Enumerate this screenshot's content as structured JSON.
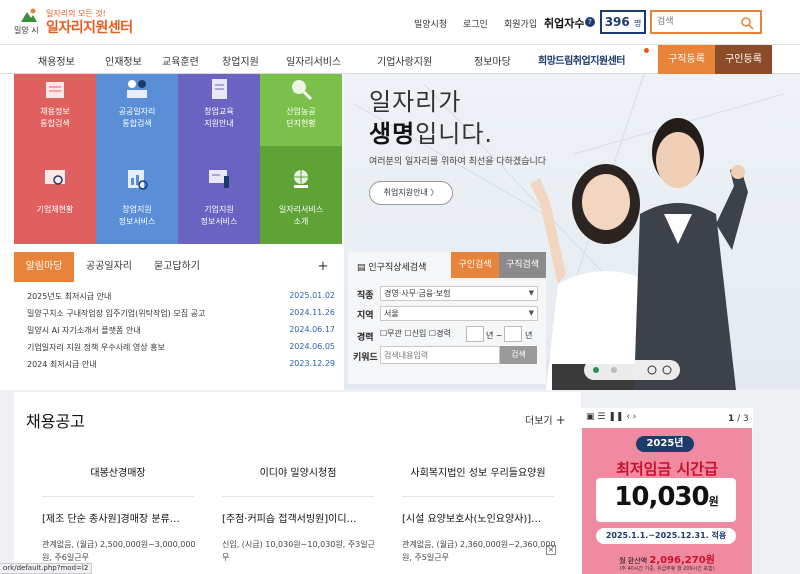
{
  "header": {
    "logo_slogan": "일자리의 모든 것!",
    "logo_title": "일자리지원센터",
    "logo_city": "밀양 시",
    "links": [
      "밀양시청",
      "로그인",
      "회원가입"
    ],
    "job_count_label": "취업자수",
    "job_count_value": "396",
    "job_count_unit": "명",
    "search_placeholder": "검색"
  },
  "nav": {
    "items": [
      "채용정보",
      "인재정보",
      "교육훈련",
      "창업지원",
      "일자리서비스",
      "기업사랑지원",
      "정보마당"
    ],
    "brand": "희망드림취업지원센터",
    "btn_job_post": "구직등록",
    "btn_hire_post": "구인등록"
  },
  "tiles": [
    {
      "label1": "채용정보",
      "label2": "통합검색",
      "icon": "list-search-icon",
      "color": "#e06060"
    },
    {
      "label1": "공공일자리",
      "label2": "통합검색",
      "icon": "people-icon",
      "color": "#5a8fd8"
    },
    {
      "label1": "창업교육",
      "label2": "지원안내",
      "icon": "document-icon",
      "color": "#6a63c2"
    },
    {
      "label1": "산업농공",
      "label2": "단지현황",
      "icon": "magnifier-icon",
      "color": "#7bc04a"
    },
    {
      "label1": "기업체현황",
      "label2": "",
      "icon": "monitor-search-icon",
      "color": "#e06060"
    },
    {
      "label1": "창업지원",
      "label2": "정보서비스",
      "icon": "chart-search-icon",
      "color": "#5a8fd8"
    },
    {
      "label1": "기업지원",
      "label2": "정보서비스",
      "icon": "presentation-icon",
      "color": "#6a63c2"
    },
    {
      "label1": "일자리서비스",
      "label2": "소개",
      "icon": "globe-icon",
      "color": "#5fa336"
    }
  ],
  "hero": {
    "title1": "일자리가",
    "title2a": "생명",
    "title2b": "입니다.",
    "subtitle": "여러분의 일자리를 위하여 최선을 다하겠습니다",
    "button": "취업지원안내"
  },
  "notice": {
    "tabs": [
      "알림마당",
      "공공일자리",
      "묻고답하기"
    ],
    "add": "+",
    "items": [
      {
        "title": "2025년도 최저시급 안내",
        "date": "2025.01.02"
      },
      {
        "title": "밀양구치소 구내작업장 입주기업(위탁작업) 모집 공고",
        "date": "2024.11.26"
      },
      {
        "title": "밀양시 AI 자기소개서 플랫폼 안내",
        "date": "2024.06.17"
      },
      {
        "title": "기업일자리 지원 정책 우수사례 영상 홍보",
        "date": "2024.06.05"
      },
      {
        "title": "2024 최저시급 안내",
        "date": "2023.12.29"
      }
    ]
  },
  "job_search": {
    "title": "인구직상세검색",
    "tab_seek": "구인검색",
    "tab_offer": "구직검색",
    "label_job": "직종",
    "value_job": "경영·사무·금융·보험",
    "label_area": "지역",
    "value_area": "서울",
    "label_career": "경력",
    "opt1": "무관",
    "opt2": "신입",
    "opt3": "경력",
    "year1": "년 ~",
    "year2": "년",
    "label_keyword": "키워드",
    "keyword_placeholder": "검색내용입력",
    "search_btn": "검색"
  },
  "jobs": {
    "title": "채용공고",
    "more": "더보기",
    "cards": [
      {
        "company": "대봉산경매장",
        "title": "[제조 단순 종사원]경매장 분류…",
        "desc": "관계없음, (월급) 2,500,000원~3,000,000원, 주6일근무"
      },
      {
        "company": "이디야 밀양시청점",
        "title": "[주점·커피숍 접객서빙원]이디…",
        "desc": "신입, (시급) 10,030원~10,030원, 주3일근무"
      },
      {
        "company": "사회복지법인 성보 우리들요양원",
        "title": "[시설 요양보호사(노인요양사)]…",
        "desc": "관계없음, (월급) 2,360,000원~2,360,000원, 주5일근무"
      }
    ]
  },
  "banner": {
    "page": "1",
    "total": "/ 3",
    "year": "2025년",
    "title": "최저임금 시간급",
    "amount": "10,030",
    "unit": "원",
    "period": "2025.1.1.~2025.12.31. 적용",
    "monthly_label": "월 환산액",
    "monthly_value": "2,096,270원",
    "footnote": "(주 40시간 기준, 유급주휴 월 209시간 포함)"
  },
  "status_url": "ork/default.php?mod=l2"
}
